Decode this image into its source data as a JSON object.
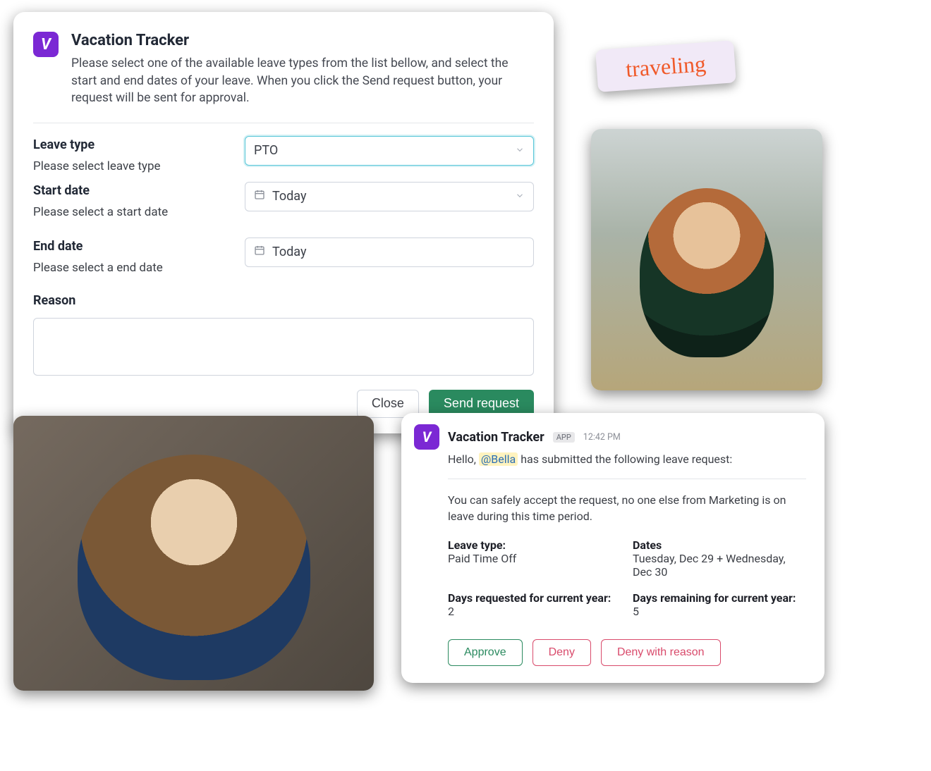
{
  "app_name": "Vacation Tracker",
  "request_form": {
    "title": "Vacation Tracker",
    "instructions": "Please select one of the available leave types from the list bellow, and select the start and end dates of your leave. When you click the Send request button, your request will be sent for approval.",
    "leave_type": {
      "label": "Leave type",
      "hint": "Please select leave type",
      "value": "PTO"
    },
    "start_date": {
      "label": "Start date",
      "hint": "Please select a start date",
      "value": "Today"
    },
    "end_date": {
      "label": "End date",
      "hint": "Please select a end date",
      "value": "Today"
    },
    "reason_label": "Reason",
    "buttons": {
      "close": "Close",
      "send": "Send request"
    }
  },
  "sticky_note": {
    "text": "traveling"
  },
  "message_card": {
    "title": "Vacation Tracker",
    "app_badge": "APP",
    "time": "12:42 PM",
    "intro_prefix": "Hello, ",
    "mention": "@Bella",
    "intro_suffix": " has submitted the following leave request:",
    "safe_msg": "You can safely accept the request, no one else from Marketing is on leave during this time period.",
    "fields": {
      "leave_type_label": "Leave type:",
      "leave_type_value": "Paid Time Off",
      "dates_label": "Dates",
      "dates_value": "Tuesday, Dec 29 + Wednesday, Dec 30",
      "days_req_label": "Days requested for current year:",
      "days_req_value": "2",
      "days_rem_label": "Days remaining for current year:",
      "days_rem_value": "5"
    },
    "buttons": {
      "approve": "Approve",
      "deny": "Deny",
      "deny_reason": "Deny with reason"
    }
  }
}
